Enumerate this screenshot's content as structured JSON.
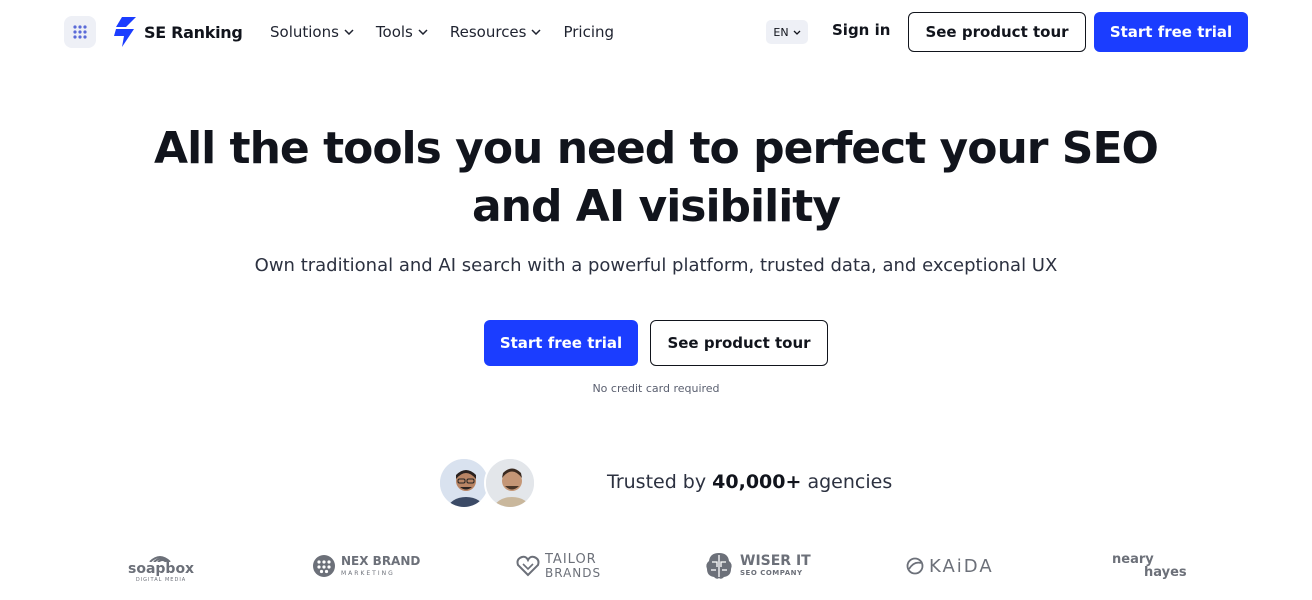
{
  "header": {
    "logo_text": "SE Ranking",
    "nav": [
      {
        "label": "Solutions",
        "has_dropdown": true
      },
      {
        "label": "Tools",
        "has_dropdown": true
      },
      {
        "label": "Resources",
        "has_dropdown": true
      },
      {
        "label": "Pricing",
        "has_dropdown": false
      }
    ],
    "language": "EN",
    "sign_in": "Sign in",
    "tour_button": "See product tour",
    "trial_button": "Start free trial"
  },
  "hero": {
    "title_line1": "All the tools you need to perfect your SEO",
    "title_line2": "and AI visibility",
    "subtitle": "Own traditional and AI search with a powerful platform, trusted data, and exceptional UX",
    "primary_cta": "Start free trial",
    "secondary_cta": "See product tour",
    "note": "No credit card required"
  },
  "trusted": {
    "prefix": "Trusted by",
    "count": "40,000+",
    "suffix": "agencies"
  },
  "brands": [
    {
      "name": "soapbox",
      "sub": "DIGITAL MEDIA"
    },
    {
      "name": "NEX BRAND",
      "sub": "MARKETING"
    },
    {
      "name": "TAILOR",
      "sub": "BRANDS"
    },
    {
      "name": "WISER IT",
      "sub": "SEO COMPANY"
    },
    {
      "name": "KAiDA",
      "sub": ""
    },
    {
      "name": "neary",
      "sub": "hayes"
    }
  ],
  "colors": {
    "primary": "#1b3dff",
    "text": "#11141c",
    "muted": "#6c7079"
  }
}
